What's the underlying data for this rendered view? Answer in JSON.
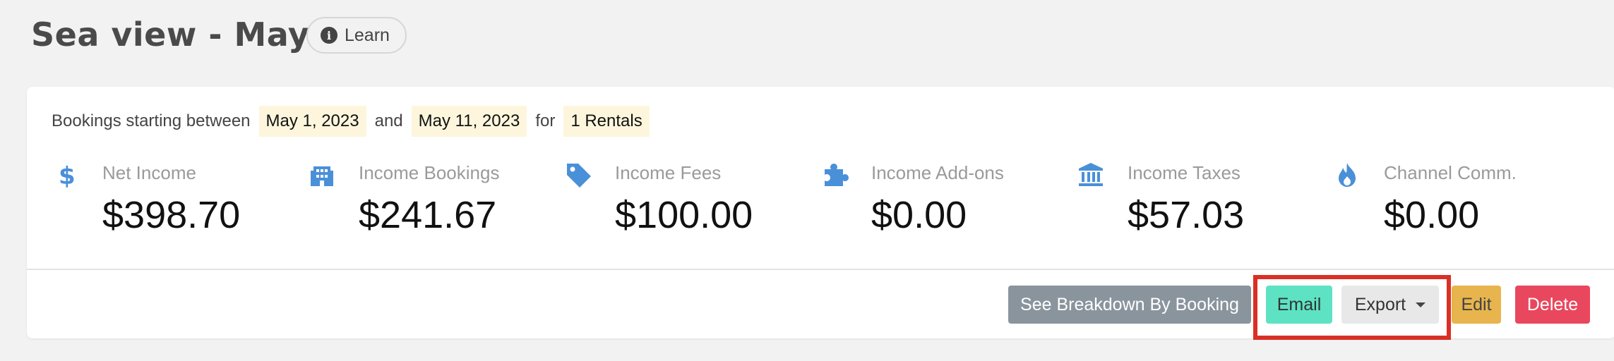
{
  "header": {
    "title": "Sea view - May",
    "learn_label": "Learn"
  },
  "filter": {
    "prefix": "Bookings starting between",
    "start_date": "May 1, 2023",
    "and": "and",
    "end_date": "May 11, 2023",
    "for": "for",
    "rentals": "1 Rentals"
  },
  "stats": [
    {
      "label": "Net Income",
      "value": "$398.70",
      "icon": "dollar-icon"
    },
    {
      "label": "Income Bookings",
      "value": "$241.67",
      "icon": "building-icon"
    },
    {
      "label": "Income Fees",
      "value": "$100.00",
      "icon": "tag-icon"
    },
    {
      "label": "Income Add-ons",
      "value": "$0.00",
      "icon": "puzzle-icon"
    },
    {
      "label": "Income Taxes",
      "value": "$57.03",
      "icon": "bank-icon"
    },
    {
      "label": "Channel Comm.",
      "value": "$0.00",
      "icon": "flame-icon"
    }
  ],
  "actions": {
    "breakdown": "See Breakdown By Booking",
    "email": "Email",
    "export": "Export",
    "edit": "Edit",
    "delete": "Delete"
  },
  "colors": {
    "icon_blue": "#4a90d9",
    "email_bg": "#5de3c3",
    "edit_bg": "#e8b44d",
    "delete_bg": "#e9475e",
    "breakdown_bg": "#8a949d",
    "highlight": "#d93025"
  }
}
